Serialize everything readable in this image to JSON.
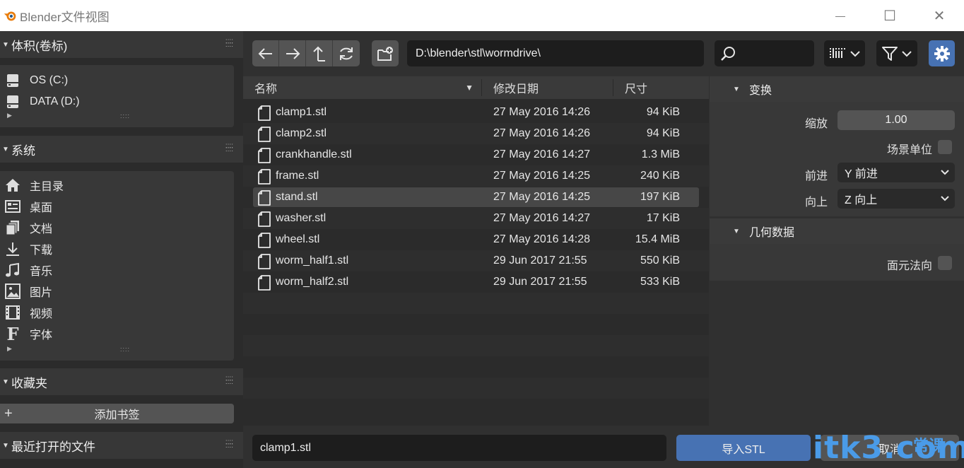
{
  "window": {
    "title": "Blender文件视图",
    "minimize_glyph": "—",
    "maximize_glyph": "☐",
    "close_glyph": "✕"
  },
  "sidebar": {
    "volumes": {
      "title": "体积(卷标)",
      "items": [
        {
          "label": "OS (C:)",
          "icon": "drive-icon"
        },
        {
          "label": "DATA (D:)",
          "icon": "drive-icon"
        }
      ]
    },
    "system": {
      "title": "系统",
      "items": [
        {
          "label": "主目录",
          "icon": "home-icon"
        },
        {
          "label": "桌面",
          "icon": "desktop-icon"
        },
        {
          "label": "文档",
          "icon": "documents-icon"
        },
        {
          "label": "下载",
          "icon": "download-icon"
        },
        {
          "label": "音乐",
          "icon": "music-icon"
        },
        {
          "label": "图片",
          "icon": "image-icon"
        },
        {
          "label": "视频",
          "icon": "video-icon"
        },
        {
          "label": "字体",
          "icon": "font-icon"
        }
      ]
    },
    "favorites": {
      "title": "收藏夹",
      "add_bookmark": "添加书签"
    },
    "recent": {
      "title": "最近打开的文件"
    }
  },
  "toolbar": {
    "path": "D:\\blender\\stl\\wormdrive\\",
    "search_value": "",
    "accent_color": "#4772b3"
  },
  "filelist": {
    "columns": {
      "name": "名称",
      "date": "修改日期",
      "size": "尺寸"
    },
    "files": [
      {
        "name": "clamp1.stl",
        "date": "27 May 2016 14:26",
        "size": "94 KiB"
      },
      {
        "name": "clamp2.stl",
        "date": "27 May 2016 14:26",
        "size": "94 KiB"
      },
      {
        "name": "crankhandle.stl",
        "date": "27 May 2016 14:27",
        "size": "1.3 MiB"
      },
      {
        "name": "frame.stl",
        "date": "27 May 2016 14:25",
        "size": "240 KiB"
      },
      {
        "name": "stand.stl",
        "date": "27 May 2016 14:25",
        "size": "197 KiB"
      },
      {
        "name": "washer.stl",
        "date": "27 May 2016 14:27",
        "size": "17 KiB"
      },
      {
        "name": "wheel.stl",
        "date": "27 May 2016 14:28",
        "size": "15.4 MiB"
      },
      {
        "name": "worm_half1.stl",
        "date": "29 Jun 2017 21:55",
        "size": "550 KiB"
      },
      {
        "name": "worm_half2.stl",
        "date": "29 Jun 2017 21:55",
        "size": "533 KiB"
      }
    ],
    "highlighted_file": "stand.stl"
  },
  "props": {
    "transform": {
      "title": "变换",
      "scale_label": "缩放",
      "scale_value": "1.00",
      "scene_unit_label": "场景单位",
      "forward_label": "前进",
      "forward_value": "Y 前进",
      "up_label": "向上",
      "up_value": "Z 向上"
    },
    "geometry": {
      "title": "几何数据",
      "face_normals_label": "面元法向"
    }
  },
  "bottom": {
    "filename": "clamp1.stl",
    "import_label": "导入STL",
    "cancel_label": "取消"
  },
  "watermark": {
    "text": "itk3.com",
    "cn": "常课"
  }
}
